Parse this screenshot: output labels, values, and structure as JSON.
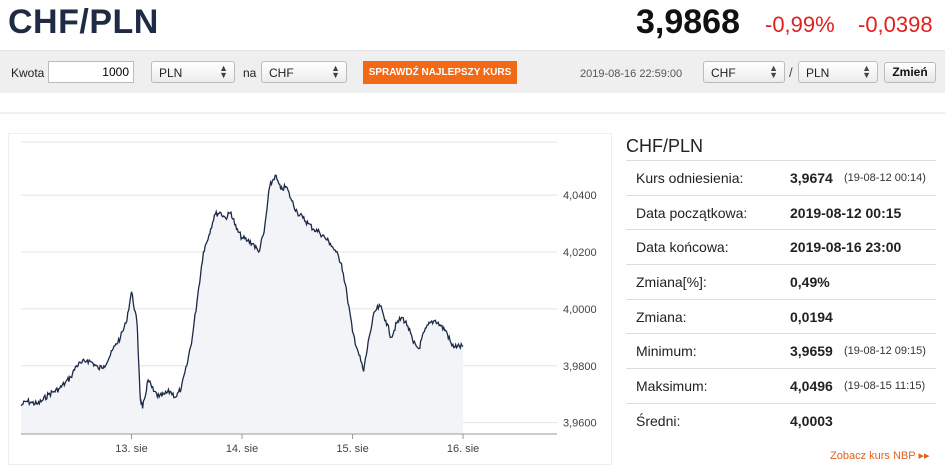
{
  "header": {
    "pair": "CHF/PLN",
    "rate": "3,9868",
    "change_pct": "-0,99%",
    "change_abs": "-0,0398"
  },
  "toolbar": {
    "amount_label": "Kwota",
    "amount_value": "1000",
    "from_currency": "PLN",
    "na_label": "na",
    "to_currency": "CHF",
    "cta_label": "SPRAWDŹ NAJLEPSZY KURS",
    "datetime": "2019-08-16 22:59:00",
    "base_currency": "CHF",
    "slash": "/",
    "quote_currency": "PLN",
    "swap_label": "Zmień"
  },
  "stats": {
    "title": "CHF/PLN",
    "rows": [
      {
        "label": "Kurs odniesienia:",
        "value": "3,9674",
        "time": "(19-08-12 00:14)"
      },
      {
        "label": "Data początkowa:",
        "value": "2019-08-12 00:15",
        "time": ""
      },
      {
        "label": "Data końcowa:",
        "value": "2019-08-16 23:00",
        "time": ""
      },
      {
        "label": "Zmiana[%]:",
        "value": "0,49%",
        "time": ""
      },
      {
        "label": "Zmiana:",
        "value": "0,0194",
        "time": ""
      },
      {
        "label": "Minimum:",
        "value": "3,9659",
        "time": "(19-08-12 09:15)"
      },
      {
        "label": "Maksimum:",
        "value": "4,0496",
        "time": "(19-08-15 11:15)"
      },
      {
        "label": "Średni:",
        "value": "4,0003",
        "time": ""
      }
    ]
  },
  "nbp_link": "Zobacz kurs NBP",
  "nbp_arrow": "▸▸",
  "colors": {
    "line": "#1c2a48",
    "area": "#f2f4f8",
    "accent": "#f26a16",
    "negative": "#e02020"
  },
  "chart_data": {
    "type": "area",
    "x_ticks": [
      "13. sie",
      "14. sie",
      "15. sie",
      "16. sie"
    ],
    "y_ticks": [
      "4,0400",
      "4,0200",
      "4,0000",
      "3,9800",
      "3,9600"
    ],
    "ylim": [
      3.956,
      4.058
    ],
    "x": [
      0,
      0.05,
      0.1,
      0.15,
      0.2,
      0.25,
      0.3,
      0.35,
      0.4,
      0.45,
      0.5,
      0.55,
      0.6,
      0.65,
      0.7,
      0.75,
      0.8,
      0.85,
      0.9,
      0.95,
      1.0,
      1.05,
      1.08,
      1.1,
      1.15,
      1.2,
      1.25,
      1.3,
      1.35,
      1.4,
      1.45,
      1.5,
      1.55,
      1.6,
      1.65,
      1.7,
      1.75,
      1.8,
      1.85,
      1.9,
      1.95,
      2.0,
      2.05,
      2.1,
      2.15,
      2.2,
      2.25,
      2.3,
      2.35,
      2.4,
      2.45,
      2.5,
      2.55,
      2.6,
      2.65,
      2.7,
      2.75,
      2.8,
      2.85,
      2.9,
      2.95,
      3.0,
      3.05,
      3.1,
      3.15,
      3.2,
      3.25,
      3.3,
      3.35,
      3.4,
      3.45,
      3.5,
      3.55,
      3.6,
      3.65,
      3.7,
      3.75,
      3.8,
      3.85,
      3.9,
      3.95,
      4.0
    ],
    "y": [
      3.966,
      3.9675,
      3.967,
      3.9665,
      3.968,
      3.97,
      3.971,
      3.972,
      3.974,
      3.976,
      3.98,
      3.981,
      3.982,
      3.981,
      3.979,
      3.98,
      3.983,
      3.987,
      3.99,
      3.995,
      4.006,
      3.995,
      3.968,
      3.965,
      3.975,
      3.971,
      3.969,
      3.97,
      3.971,
      3.969,
      3.972,
      3.98,
      3.99,
      4.005,
      4.02,
      4.026,
      4.033,
      4.034,
      4.032,
      4.034,
      4.028,
      4.025,
      4.024,
      4.023,
      4.02,
      4.027,
      4.043,
      4.047,
      4.042,
      4.043,
      4.038,
      4.034,
      4.032,
      4.03,
      4.028,
      4.027,
      4.025,
      4.023,
      4.02,
      4.016,
      4.005,
      3.992,
      3.985,
      3.978,
      3.99,
      3.999,
      4.001,
      3.996,
      3.99,
      3.995,
      3.997,
      3.994,
      3.988,
      3.986,
      3.992,
      3.995,
      3.996,
      3.994,
      3.992,
      3.987,
      3.9868,
      3.9868
    ],
    "grid": true
  }
}
